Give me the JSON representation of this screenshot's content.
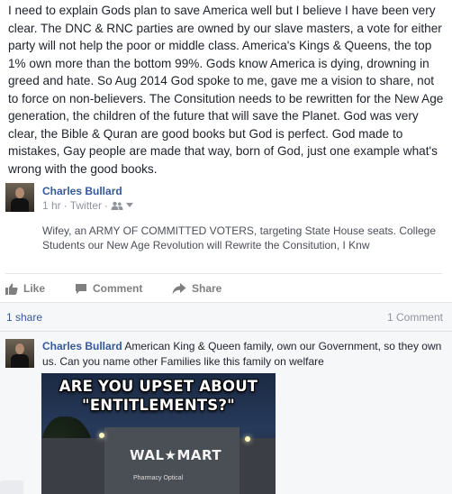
{
  "post": {
    "text": "I need to explain Gods plan to save America well but I believe I have been very clear. The DNC & RNC parties are owned by our slave masters, a vote for either party will not help the poor or middle class. America's Kings & Queens, the top 1% own more than the bottom 99%. Gods know America is dying, drowning in greed and hate. So Aug 2014 God spoke to me, gave me a vision to share, not to force on non-believers. The Consitution needs to be rewritten for the New Age generation, the children of the future that will save the Planet. God was very clear, the Bible & Quran are good books but God is perfect. God made to mistakes, Gay people are made that way, born of God, just one example what's wrong with the good books."
  },
  "shared": {
    "author": "Charles Bullard",
    "time": "1 hr",
    "separator": "·",
    "source": "Twitter",
    "audience_icon": "friends-icon",
    "text": "Wifey, an ARMY OF COMMITTED VOTERS, targeting State House seats. College Students our New Age Revolution will Rewrite the Consitution, I Knw"
  },
  "actions": {
    "like": "Like",
    "comment": "Comment",
    "share": "Share"
  },
  "stats": {
    "shares": "1 share",
    "comments": "1 Comment"
  },
  "comment": {
    "author": "Charles Bullard",
    "text": " American King & Queen family, own our Government, so they own us. Can you name other Families like this family on welfare",
    "image": {
      "line1": "ARE YOU UPSET ABOUT",
      "line2": "\"ENTITLEMENTS?\"",
      "logo": "WAL★MART",
      "sign": "Pharmacy      Optical"
    }
  },
  "colors": {
    "link": "#365899",
    "muted": "#90949c",
    "action": "#7f7f7f",
    "bg_alt": "#f6f7f9"
  }
}
